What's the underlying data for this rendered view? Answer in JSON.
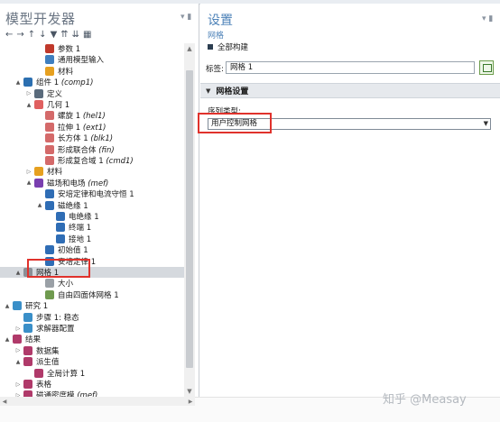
{
  "left_panel": {
    "title": "模型开发器",
    "pin": "▾ ▮",
    "toolbar_icons": [
      "arrow-left-icon",
      "arrow-right-icon",
      "arrow-up-icon",
      "arrow-down-icon",
      "show-icon",
      "expand-all-icon",
      "collapse-all-icon",
      "grid-icon"
    ],
    "toolbar_glyphs": [
      "←",
      "→",
      "↑",
      "↓",
      "▼",
      "⇈",
      "⇊",
      "▦"
    ]
  },
  "tree": [
    {
      "depth": 3,
      "expander": "",
      "icon": "parameter-icon",
      "color": "#c0392b",
      "label": "参数 1",
      "extra": ""
    },
    {
      "depth": 3,
      "expander": "",
      "icon": "model-input-icon",
      "color": "#3f7fbf",
      "label": "通用模型输入",
      "extra": ""
    },
    {
      "depth": 3,
      "expander": "",
      "icon": "material-icon",
      "color": "#e6a020",
      "label": "材料",
      "extra": ""
    },
    {
      "depth": 1,
      "expander": "▲",
      "icon": "component-icon",
      "color": "#2c6fb0",
      "label": "组件 1",
      "extra": "(comp1)"
    },
    {
      "depth": 2,
      "expander": "▷",
      "icon": "definitions-icon",
      "color": "#5a6b7c",
      "label": "定义",
      "extra": ""
    },
    {
      "depth": 2,
      "expander": "▲",
      "icon": "geometry-icon",
      "color": "#e06060",
      "label": "几何 1",
      "extra": ""
    },
    {
      "depth": 3,
      "expander": "",
      "icon": "revolve-icon",
      "color": "#d46a6a",
      "label": "螺旋 1",
      "extra": "(hel1)"
    },
    {
      "depth": 3,
      "expander": "",
      "icon": "extrude-icon",
      "color": "#d46a6a",
      "label": "拉伸 1",
      "extra": "(ext1)"
    },
    {
      "depth": 3,
      "expander": "",
      "icon": "block-icon",
      "color": "#d46a6a",
      "label": "长方体 1",
      "extra": "(blk1)"
    },
    {
      "depth": 3,
      "expander": "",
      "icon": "union-icon",
      "color": "#d46a6a",
      "label": "形成联合体",
      "extra": "(fin)"
    },
    {
      "depth": 3,
      "expander": "",
      "icon": "composite-icon",
      "color": "#d46a6a",
      "label": "形成复合域 1",
      "extra": "(cmd1)"
    },
    {
      "depth": 2,
      "expander": "▷",
      "icon": "material-icon",
      "color": "#e6a020",
      "label": "材料",
      "extra": ""
    },
    {
      "depth": 2,
      "expander": "▲",
      "icon": "magnetic-fields-icon",
      "color": "#7a3fb0",
      "label": "磁场和电场",
      "extra": "(mef)"
    },
    {
      "depth": 3,
      "expander": "",
      "icon": "physics-node-icon",
      "color": "#2f6db5",
      "label": "安培定律和电流守恒 1",
      "extra": ""
    },
    {
      "depth": 3,
      "expander": "▲",
      "icon": "physics-node-icon",
      "color": "#2f6db5",
      "label": "磁绝缘 1",
      "extra": ""
    },
    {
      "depth": 4,
      "expander": "",
      "icon": "boundary-icon",
      "color": "#2f6db5",
      "label": "电绝缘 1",
      "extra": ""
    },
    {
      "depth": 4,
      "expander": "",
      "icon": "boundary-icon",
      "color": "#2f6db5",
      "label": "终端 1",
      "extra": ""
    },
    {
      "depth": 4,
      "expander": "",
      "icon": "boundary-icon",
      "color": "#2f6db5",
      "label": "接地 1",
      "extra": ""
    },
    {
      "depth": 3,
      "expander": "",
      "icon": "initial-values-icon",
      "color": "#2f6db5",
      "label": "初始值 1",
      "extra": ""
    },
    {
      "depth": 3,
      "expander": "",
      "icon": "physics-node-icon",
      "color": "#2f6db5",
      "label": "安培定律 1",
      "extra": ""
    },
    {
      "depth": 1,
      "expander": "▲",
      "icon": "mesh-icon",
      "color": "#8a8f96",
      "label": "网格 1",
      "extra": "",
      "selected": true
    },
    {
      "depth": 3,
      "expander": "",
      "icon": "size-icon",
      "color": "#9aa0a6",
      "label": "大小",
      "extra": ""
    },
    {
      "depth": 3,
      "expander": "",
      "icon": "free-tetrahedral-icon",
      "color": "#6f9a4f",
      "label": "自由四面体网格 1",
      "extra": ""
    },
    {
      "depth": 0,
      "expander": "▲",
      "icon": "study-icon",
      "color": "#3a8fc8",
      "label": "研究 1",
      "extra": ""
    },
    {
      "depth": 1,
      "expander": "",
      "icon": "study-step-icon",
      "color": "#3a8fc8",
      "label": "步骤 1: 稳态",
      "extra": ""
    },
    {
      "depth": 1,
      "expander": "▷",
      "icon": "solver-icon",
      "color": "#3a8fc8",
      "label": "求解器配置",
      "extra": ""
    },
    {
      "depth": 0,
      "expander": "▲",
      "icon": "results-icon",
      "color": "#b03a6a",
      "label": "结果",
      "extra": ""
    },
    {
      "depth": 1,
      "expander": "▷",
      "icon": "datasets-icon",
      "color": "#b03a6a",
      "label": "数据集",
      "extra": ""
    },
    {
      "depth": 1,
      "expander": "▲",
      "icon": "derived-values-icon",
      "color": "#b03a6a",
      "label": "派生值",
      "extra": ""
    },
    {
      "depth": 2,
      "expander": "",
      "icon": "global-eval-icon",
      "color": "#b03a6a",
      "label": "全局计算 1",
      "extra": ""
    },
    {
      "depth": 1,
      "expander": "▷",
      "icon": "tables-icon",
      "color": "#b03a6a",
      "label": "表格",
      "extra": ""
    },
    {
      "depth": 1,
      "expander": "▷",
      "icon": "plot-group-icon",
      "color": "#b03a6a",
      "label": "磁通密度模",
      "extra": "(mef)"
    }
  ],
  "right_panel": {
    "title": "设置",
    "pin": "▾ ▮",
    "subtitle": "网格",
    "build_all": "全部构建",
    "label_caption": "标签:",
    "label_value": "网格 1",
    "section_title": "网格设置",
    "sequence_label": "序列类型:",
    "sequence_value": "用户控制网格"
  },
  "watermark": "知乎 @Measay",
  "colors": {
    "accent": "#4d82b8",
    "highlight": "#e0322c",
    "selected_row": "#d5d9de"
  }
}
